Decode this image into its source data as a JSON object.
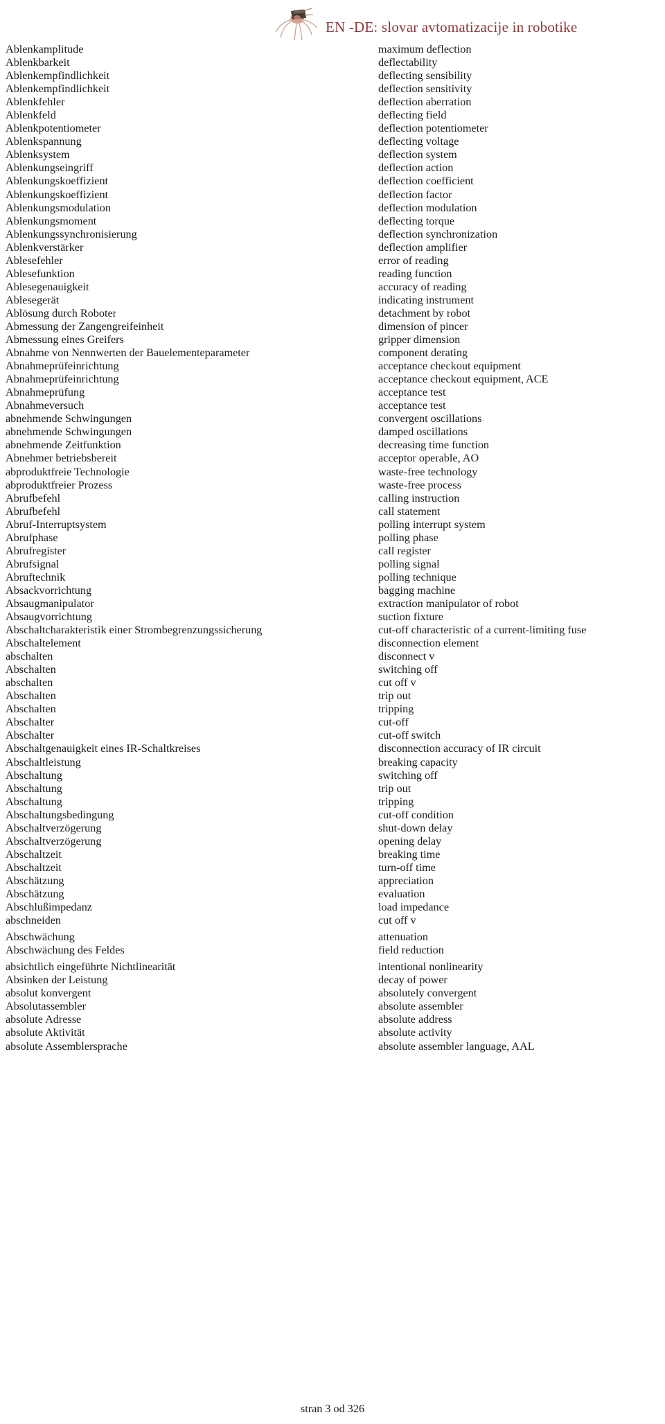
{
  "header": {
    "title": "EN -DE: slovar avtomatizacije in robotike",
    "title_color": "#8a3a3a",
    "logo_icon": "spider-robot-image"
  },
  "glossary": {
    "entries": [
      {
        "de": "Ablenkamplitude",
        "en": "maximum deflection"
      },
      {
        "de": "Ablenkbarkeit",
        "en": "deflectability"
      },
      {
        "de": "Ablenkempfindlichkeit",
        "en": "deflecting sensibility"
      },
      {
        "de": "Ablenkempfindlichkeit",
        "en": "deflection sensitivity"
      },
      {
        "de": "Ablenkfehler",
        "en": "deflection aberration"
      },
      {
        "de": "Ablenkfeld",
        "en": "deflecting field"
      },
      {
        "de": "Ablenkpotentiometer",
        "en": "deflection potentiometer"
      },
      {
        "de": "Ablenkspannung",
        "en": "deflecting voltage"
      },
      {
        "de": "Ablenksystem",
        "en": "deflection system"
      },
      {
        "de": "Ablenkungseingriff",
        "en": "deflection action"
      },
      {
        "de": "Ablenkungskoeffizient",
        "en": "deflection coefficient"
      },
      {
        "de": "Ablenkungskoeffizient",
        "en": "deflection factor"
      },
      {
        "de": "Ablenkungsmodulation",
        "en": "deflection modulation"
      },
      {
        "de": "Ablenkungsmoment",
        "en": "deflecting torque"
      },
      {
        "de": "Ablenkungssynchronisierung",
        "en": "deflection synchronization"
      },
      {
        "de": "Ablenkverstärker",
        "en": "deflection amplifier"
      },
      {
        "de": "Ablesefehler",
        "en": "error of reading"
      },
      {
        "de": "Ablesefunktion",
        "en": "reading function"
      },
      {
        "de": "Ablesegenauigkeit",
        "en": "accuracy of reading"
      },
      {
        "de": "Ablesegerät",
        "en": "indicating instrument"
      },
      {
        "de": "Ablösung durch Roboter",
        "en": "detachment by robot"
      },
      {
        "de": "Abmessung der Zangengreifeinheit",
        "en": "dimension of pincer"
      },
      {
        "de": "Abmessung eines Greifers",
        "en": "gripper dimension"
      },
      {
        "de": "Abnahme von Nennwerten der Bauelementeparameter",
        "en": "component derating"
      },
      {
        "de": "Abnahmeprüfeinrichtung",
        "en": "acceptance checkout equipment"
      },
      {
        "de": "Abnahmeprüfeinrichtung",
        "en": "acceptance checkout equipment, ACE"
      },
      {
        "de": "Abnahmeprüfung",
        "en": "acceptance test"
      },
      {
        "de": "Abnahmeversuch",
        "en": "acceptance test"
      },
      {
        "de": "abnehmende Schwingungen",
        "en": "convergent oscillations"
      },
      {
        "de": "abnehmende Schwingungen",
        "en": "damped oscillations"
      },
      {
        "de": "abnehmende Zeitfunktion",
        "en": "decreasing time function"
      },
      {
        "de": "Abnehmer betriebsbereit",
        "en": "acceptor operable, AO"
      },
      {
        "de": "abproduktfreie Technologie",
        "en": "waste-free technology"
      },
      {
        "de": "abproduktfreier Prozess",
        "en": "waste-free process"
      },
      {
        "de": "Abrufbefehl",
        "en": "calling instruction"
      },
      {
        "de": "Abrufbefehl",
        "en": "call statement"
      },
      {
        "de": "Abruf-Interruptsystem",
        "en": "polling interrupt system"
      },
      {
        "de": "Abrufphase",
        "en": "polling phase"
      },
      {
        "de": "Abrufregister",
        "en": "call register"
      },
      {
        "de": "Abrufsignal",
        "en": "polling signal"
      },
      {
        "de": "Abruftechnik",
        "en": "polling technique"
      },
      {
        "de": "Absackvorrichtung",
        "en": "bagging machine"
      },
      {
        "de": "Absaugmanipulator",
        "en": "extraction manipulator of robot"
      },
      {
        "de": "Absaugvorrichtung",
        "en": "suction fixture"
      },
      {
        "de": "Abschaltcharakteristik einer Strombegrenzungssicherung",
        "en": "cut-off characteristic of a current-limiting fuse"
      },
      {
        "de": "Abschaltelement",
        "en": "disconnection element"
      },
      {
        "de": "abschalten",
        "en": "disconnect v"
      },
      {
        "de": "Abschalten",
        "en": "switching off"
      },
      {
        "de": "abschalten",
        "en": "cut off v"
      },
      {
        "de": "Abschalten",
        "en": "trip out"
      },
      {
        "de": "Abschalten",
        "en": "tripping"
      },
      {
        "de": "Abschalter",
        "en": "cut-off"
      },
      {
        "de": "Abschalter",
        "en": "cut-off switch"
      },
      {
        "de": "Abschaltgenauigkeit eines IR-Schaltkreises",
        "en": "disconnection accuracy of IR circuit"
      },
      {
        "de": "Abschaltleistung",
        "en": "breaking capacity"
      },
      {
        "de": "Abschaltung",
        "en": "switching off"
      },
      {
        "de": "Abschaltung",
        "en": "trip out"
      },
      {
        "de": "Abschaltung",
        "en": "tripping"
      },
      {
        "de": "Abschaltungsbedingung",
        "en": "cut-off condition"
      },
      {
        "de": "Abschaltverzögerung",
        "en": "shut-down delay"
      },
      {
        "de": "Abschaltverzögerung",
        "en": "opening delay"
      },
      {
        "de": "Abschaltzeit",
        "en": "breaking time"
      },
      {
        "de": "Abschaltzeit",
        "en": "turn-off time"
      },
      {
        "de": "Abschätzung",
        "en": "appreciation"
      },
      {
        "de": "Abschätzung",
        "en": "evaluation"
      },
      {
        "de": "Abschlußimpedanz",
        "en": "load impedance"
      },
      {
        "de": "abschneiden",
        "en": "cut off v"
      },
      {
        "de": "Abschwächung",
        "en": "attenuation",
        "gap": true
      },
      {
        "de": "Abschwächung des Feldes",
        "en": "field reduction"
      },
      {
        "de": "absichtlich eingeführte Nichtlinearität",
        "en": "intentional nonlinearity",
        "gap": true
      },
      {
        "de": "Absinken der Leistung",
        "en": "decay of power"
      },
      {
        "de": "absolut konvergent",
        "en": "absolutely convergent"
      },
      {
        "de": "Absolutassembler",
        "en": "absolute assembler"
      },
      {
        "de": "absolute Adresse",
        "en": "absolute address"
      },
      {
        "de": "absolute Aktivität",
        "en": "absolute activity"
      },
      {
        "de": "absolute Assemblersprache",
        "en": "absolute assembler language, AAL"
      }
    ]
  },
  "footer": {
    "page_label": "stran 3 od 326"
  }
}
